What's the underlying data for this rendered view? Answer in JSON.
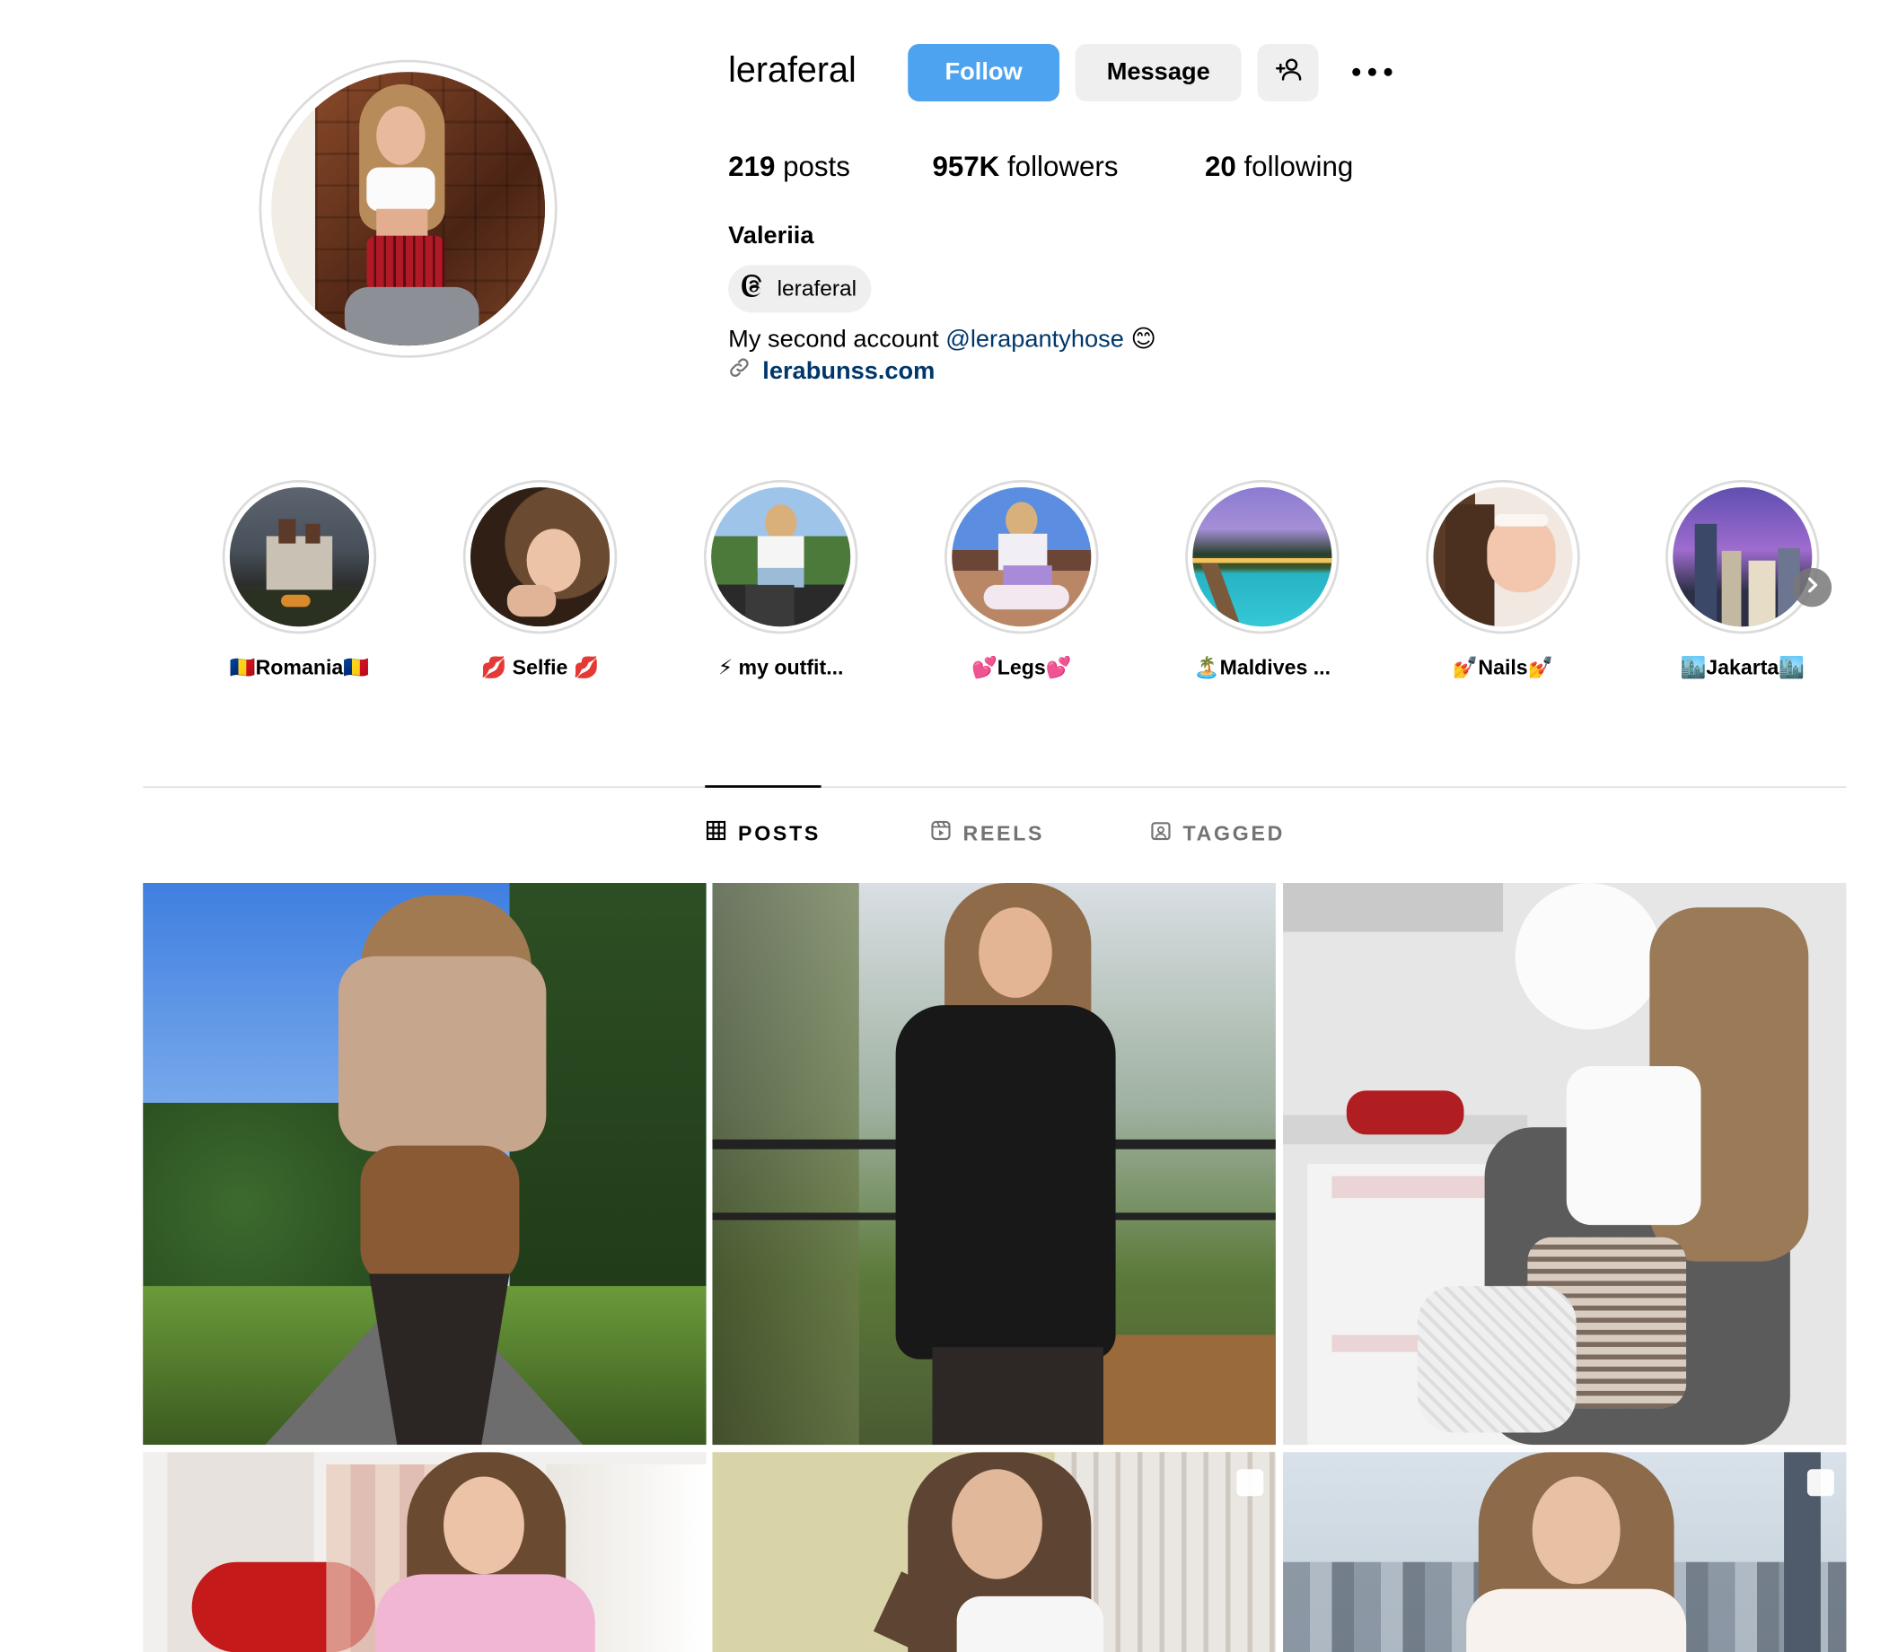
{
  "profile": {
    "username": "leraferal",
    "follow_label": "Follow",
    "message_label": "Message",
    "suggest_icon": "add-person-icon",
    "more_icon": "more-horizontal-icon",
    "stats": [
      {
        "value": "219",
        "label": "posts"
      },
      {
        "value": "957K",
        "label": "followers"
      },
      {
        "value": "20",
        "label": "following"
      }
    ],
    "full_name": "Valeriia",
    "threads": {
      "icon": "threads-icon",
      "label": "leraferal"
    },
    "bio": {
      "text": "My second account ",
      "mention": "@lerapantyhose",
      "emoji": "😊"
    },
    "link": {
      "icon": "link-icon",
      "label": "lerabunss.com"
    }
  },
  "highlights": [
    {
      "label": "🇷🇴Romania🇷🇴"
    },
    {
      "label": "💋 Selfie 💋"
    },
    {
      "label": "⚡ my outfit..."
    },
    {
      "label": "💕Legs💕"
    },
    {
      "label": "🏝️Maldives ..."
    },
    {
      "label": "💅Nails💅"
    },
    {
      "label": "🏙️Jakarta🏙️"
    }
  ],
  "tabs": [
    {
      "label": "POSTS",
      "icon": "grid-icon",
      "active": true
    },
    {
      "label": "REELS",
      "icon": "reels-icon",
      "active": false
    },
    {
      "label": "TAGGED",
      "icon": "tagged-icon",
      "active": false
    }
  ],
  "colors": {
    "follow_button": "#4da3f0",
    "secondary_button": "#efefef",
    "link": "#00376b",
    "divider": "#dbdbdb"
  }
}
